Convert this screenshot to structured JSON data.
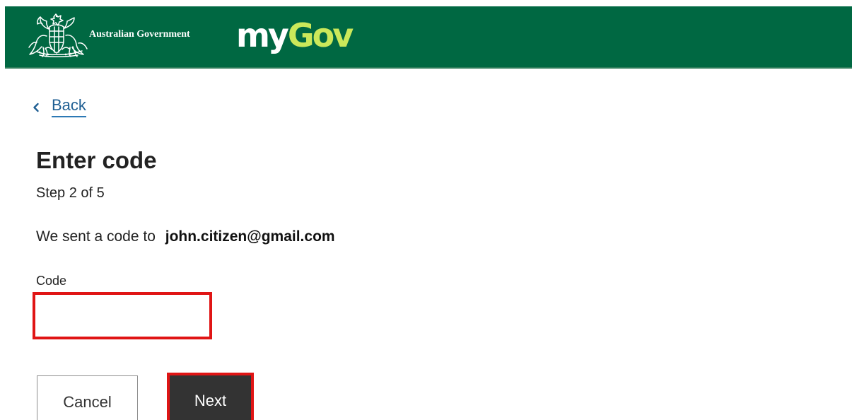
{
  "header": {
    "government_name": "Australian Government",
    "crest_icon": "australian-coat-of-arms-icon",
    "logo": {
      "my": "my",
      "gov": "Gov"
    },
    "colors": {
      "header_background": "#006842",
      "logo_gov": "#cbe85a"
    }
  },
  "navigation": {
    "back_icon": "chevron-left-icon",
    "back_label": "Back"
  },
  "page": {
    "title": "Enter code",
    "step": "Step 2 of 5",
    "sent_prefix": "We sent a code to",
    "email": "john.citizen@gmail.com"
  },
  "form": {
    "code_label": "Code",
    "code_value": ""
  },
  "actions": {
    "cancel_label": "Cancel",
    "next_label": "Next"
  },
  "highlight_color": "#e01515"
}
